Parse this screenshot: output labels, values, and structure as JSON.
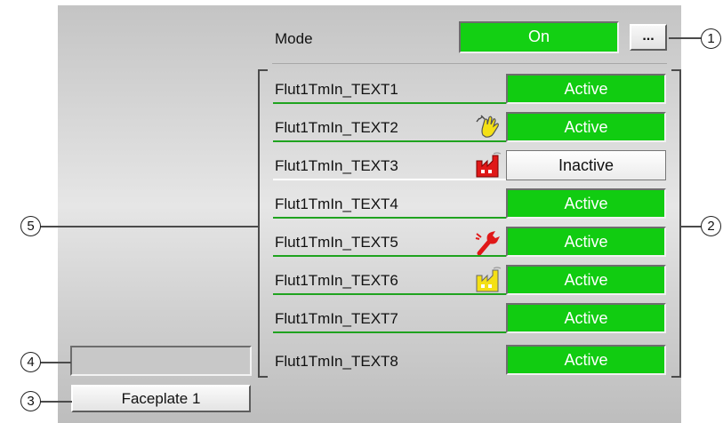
{
  "mode": {
    "label": "Mode",
    "value": "On",
    "button_label": "..."
  },
  "rows": [
    {
      "label": "Flut1TmIn_TEXT1",
      "status": "Active",
      "icon": ""
    },
    {
      "label": "Flut1TmIn_TEXT2",
      "status": "Active",
      "icon": "manual-hand-icon"
    },
    {
      "label": "Flut1TmIn_TEXT3",
      "status": "Inactive",
      "icon": "plant-factory-icon"
    },
    {
      "label": "Flut1TmIn_TEXT4",
      "status": "Active",
      "icon": ""
    },
    {
      "label": "Flut1TmIn_TEXT5",
      "status": "Active",
      "icon": "maintenance-wrench-icon"
    },
    {
      "label": "Flut1TmIn_TEXT6",
      "status": "Active",
      "icon": "simulation-factory-icon"
    },
    {
      "label": "Flut1TmIn_TEXT7",
      "status": "Active",
      "icon": ""
    },
    {
      "label": "Flut1TmIn_TEXT8",
      "status": "Active",
      "icon": ""
    }
  ],
  "faceplate": {
    "button_label": "Faceplate 1"
  },
  "callouts": {
    "c1": "1",
    "c2": "2",
    "c3": "3",
    "c4": "4",
    "c5": "5"
  },
  "colors": {
    "active_green": "#11cc11",
    "row_underline": "#1fa31f"
  }
}
